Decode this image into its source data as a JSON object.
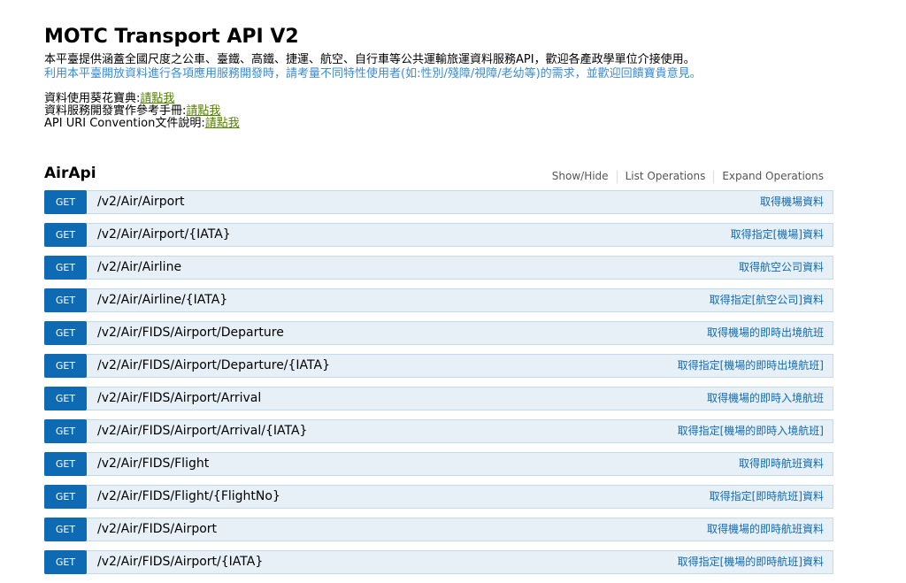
{
  "header": {
    "title": "MOTC Transport API V2",
    "description_line1": "本平臺提供涵蓋全國尺度之公車、臺鐵、高鐵、捷運、航空、自行車等公共運輸旅運資料服務API，歡迎各產政學單位介接使用。",
    "description_line2": "利用本平臺開放資料進行各項應用服務開發時，請考量不同特性使用者(如:性別/殘障/視障/老幼等)的需求，並歡迎回饋寶貴意見。",
    "links": [
      {
        "prefix": "資料使用葵花寶典:",
        "link_text": "請點我"
      },
      {
        "prefix": "資料服務開發實作參考手冊:",
        "link_text": "請點我"
      },
      {
        "prefix": "API URI Convention文件說明:",
        "link_text": "請點我"
      }
    ]
  },
  "section": {
    "title": "AirApi",
    "show_hide": "Show/Hide",
    "list_operations": "List Operations",
    "expand_operations": "Expand Operations"
  },
  "operations": [
    {
      "method": "GET",
      "path": "/v2/Air/Airport",
      "summary": "取得機場資料"
    },
    {
      "method": "GET",
      "path": "/v2/Air/Airport/{IATA}",
      "summary": "取得指定[機場]資料"
    },
    {
      "method": "GET",
      "path": "/v2/Air/Airline",
      "summary": "取得航空公司資料"
    },
    {
      "method": "GET",
      "path": "/v2/Air/Airline/{IATA}",
      "summary": "取得指定[航空公司]資料"
    },
    {
      "method": "GET",
      "path": "/v2/Air/FIDS/Airport/Departure",
      "summary": "取得機場的即時出境航班"
    },
    {
      "method": "GET",
      "path": "/v2/Air/FIDS/Airport/Departure/{IATA}",
      "summary": "取得指定[機場的即時出境航班]"
    },
    {
      "method": "GET",
      "path": "/v2/Air/FIDS/Airport/Arrival",
      "summary": "取得機場的即時入境航班"
    },
    {
      "method": "GET",
      "path": "/v2/Air/FIDS/Airport/Arrival/{IATA}",
      "summary": "取得指定[機場的即時入境航班]"
    },
    {
      "method": "GET",
      "path": "/v2/Air/FIDS/Flight",
      "summary": "取得即時航班資料"
    },
    {
      "method": "GET",
      "path": "/v2/Air/FIDS/Flight/{FlightNo}",
      "summary": "取得指定[即時航班]資料"
    },
    {
      "method": "GET",
      "path": "/v2/Air/FIDS/Airport",
      "summary": "取得機場的即時航班資料"
    },
    {
      "method": "GET",
      "path": "/v2/Air/FIDS/Airport/{IATA}",
      "summary": "取得指定[機場的即時航班]資料"
    }
  ]
}
